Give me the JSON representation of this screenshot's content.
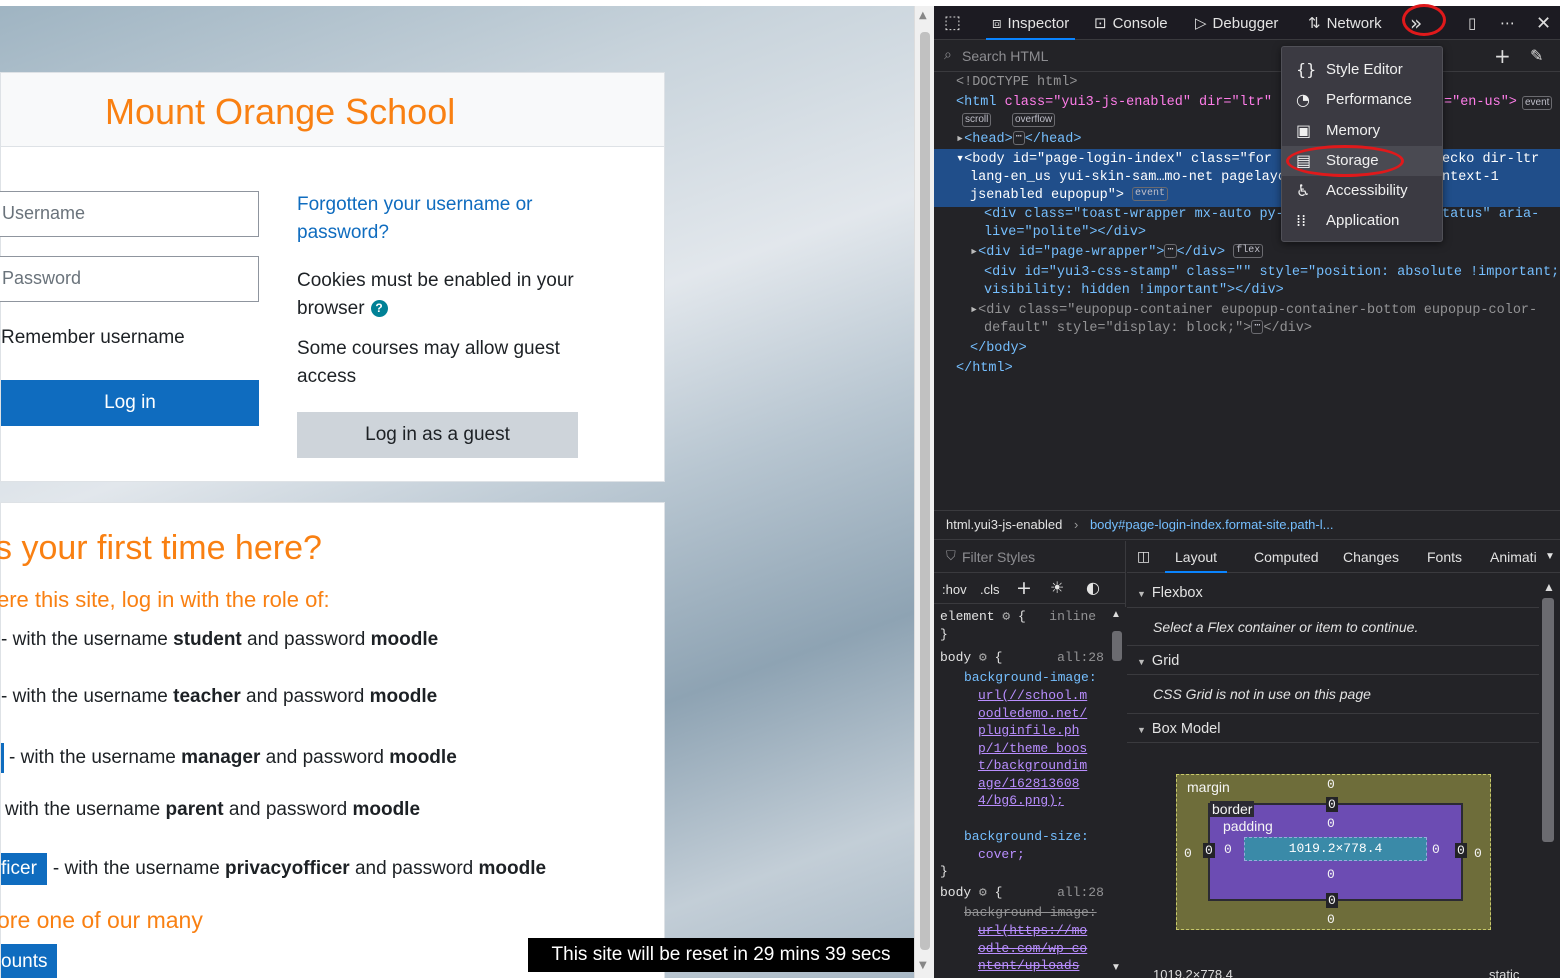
{
  "login": {
    "site_title": "Mount Orange School",
    "username_placeholder": "Username",
    "password_placeholder": "Password",
    "remember_label": "Remember username",
    "login_button": "Log in",
    "forgot_link": "Forgotten your username or password?",
    "cookies_text": "Cookies must be enabled in your browser",
    "guest_text": "Some courses may allow guest access",
    "guest_button": "Log in as a guest"
  },
  "first_time": {
    "heading": "s your first time here?",
    "subheading": "ere this site, log in with the role of:",
    "roles": [
      {
        "button": "",
        "pre": "- with the username ",
        "user": "student",
        "mid": " and password ",
        "pass": "moodle"
      },
      {
        "button": "",
        "pre": "- with the username ",
        "user": "teacher",
        "mid": " and password ",
        "pass": "moodle"
      },
      {
        "button": "",
        "pre": "- with the username ",
        "user": "manager",
        "mid": " and password ",
        "pass": "moodle"
      },
      {
        "button": "",
        "pre": "with the username ",
        "user": "parent",
        "mid": " and password ",
        "pass": "moodle"
      },
      {
        "button": "ficer",
        "pre": "- with the username ",
        "user": "privacyofficer",
        "mid": " and password ",
        "pass": "moodle"
      }
    ],
    "explore": "ore one of our many",
    "accounts_button": "ounts"
  },
  "reset_banner": "This site will be reset in 29 mins 39 secs",
  "devtools": {
    "tabs": [
      "Inspector",
      "Console",
      "Debugger",
      "Network"
    ],
    "search_placeholder": "Search HTML",
    "menu": [
      "Style Editor",
      "Performance",
      "Memory",
      "Storage",
      "Accessibility",
      "Application"
    ],
    "breadcrumb": [
      "html.yui3-js-enabled",
      "body#page-login-index.format-site.path-l..."
    ],
    "filter_placeholder": "Filter Styles",
    "rule_toolbar": [
      ":hov",
      ".cls"
    ],
    "subtabs": [
      "Layout",
      "Computed",
      "Changes",
      "Fonts",
      "Animati"
    ],
    "sections": [
      "Flexbox",
      "Grid",
      "Box Model"
    ],
    "flex_note": "Select a Flex container or item to continue.",
    "grid_note": "CSS Grid is not in use on this page",
    "box": {
      "margin_label": "margin",
      "border_label": "border",
      "padding_label": "padding",
      "content": "1019.2×778.4",
      "zero": "0"
    },
    "footer_size": "1019.2×778.4",
    "footer_pos": "static",
    "html_lines": {
      "doctype": "<!DOCTYPE html>",
      "html_open_a": "<html ",
      "html_attr_1": "class=",
      "html_val_1": "\"yui3-js-enabled\"",
      "html_attr_2": " dir=",
      "html_val_2": "\"ltr\"",
      "html_tail": "=\"en-us\">",
      "head": "<head>",
      "head_close": "</head>",
      "body_1": "<body id=\"page-login-index\" class=\"for",
      "body_1b": "ecko dir-ltr",
      "body_2": "lang-en_us yui-skin-sam…mo-net pagelayc",
      "body_2b": "ntext-1",
      "body_3": "jsenabled eupopup\">",
      "div1a": "<div class=\"toast-wrapper mx-auto py-",
      "div1b": "tatus\" aria-",
      "div1c": "live=\"polite\"></div>",
      "div2": "<div id=\"page-wrapper\">",
      "div2c": "</div>",
      "div3a": "<div id=\"yui3-css-stamp\" class=\"\" style=\"position: absolute !important;",
      "div3b": "visibility: hidden !important\"></div>",
      "div4a": "<div class=\"eupopup-container eupopup-container-bottom eupopup-color-",
      "div4b": "default\" style=\"display: block;\">",
      "div4c": "</div>",
      "body_close": "</body>",
      "html_close": "</html>"
    },
    "badges": {
      "event": "event",
      "scroll": "scroll",
      "overflow": "overflow",
      "flex": "flex"
    },
    "rules": {
      "element": "element",
      "inline": "inline",
      "body": "body",
      "all28": "all:28",
      "prop1": "background-image:",
      "val1": "url(//school.moodledemo.net/pluginfile.php/1/theme_boost/backgroundimage/1628136084/bg6.png);",
      "prop2": "background-size:",
      "val2": "cover;",
      "prop3": "background-image:",
      "val3": "url(https://moodle.com/wp-content/uploads"
    }
  }
}
